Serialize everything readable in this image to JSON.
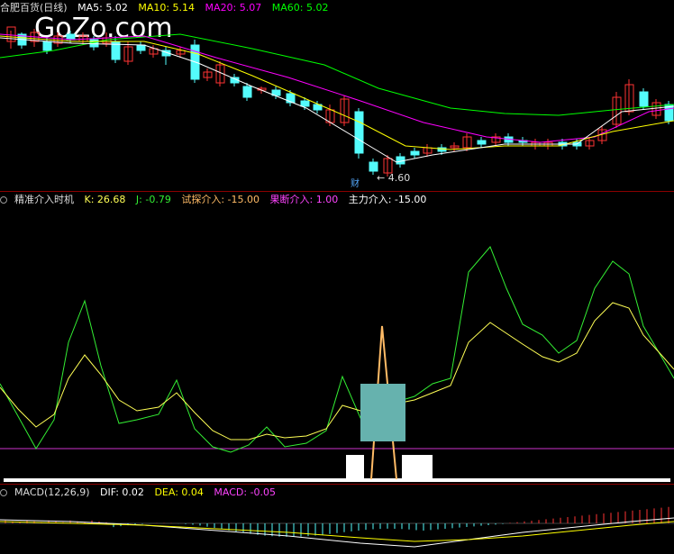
{
  "stock": {
    "title": "合肥百货(日线)",
    "watermark": "GoZo.com",
    "ma5": {
      "label": "MA5:",
      "value": "5.02",
      "color": "#ffffff"
    },
    "ma10": {
      "label": "MA10:",
      "value": "5.14",
      "color": "#ffff00"
    },
    "ma20": {
      "label": "MA20:",
      "value": "5.07",
      "color": "#ff00ff"
    },
    "ma60": {
      "label": "MA60:",
      "value": "5.02",
      "color": "#00ff00"
    },
    "low_label": "4.60",
    "event_label": "财"
  },
  "indicator": {
    "title": "精准介入时机",
    "k_label": "K: 26.68",
    "j_label": "J: -0.79",
    "trial_label": "试探介入: -15.00",
    "decisive_label": "果断介入: 1.00",
    "main_label": "主力介入: -15.00"
  },
  "macd": {
    "title": "MACD(12,26,9)",
    "dif_label": "DIF: 0.02",
    "dea_label": "DEA: 0.04",
    "macd_label": "MACD: -0.05"
  },
  "colors": {
    "up": "#ff3333",
    "down": "#54fcfc",
    "k_line": "#ffff55",
    "j_line": "#33ee33",
    "baseline": "#cc33cc",
    "box": "#66b2ae",
    "spike": "#ffbb66"
  }
}
